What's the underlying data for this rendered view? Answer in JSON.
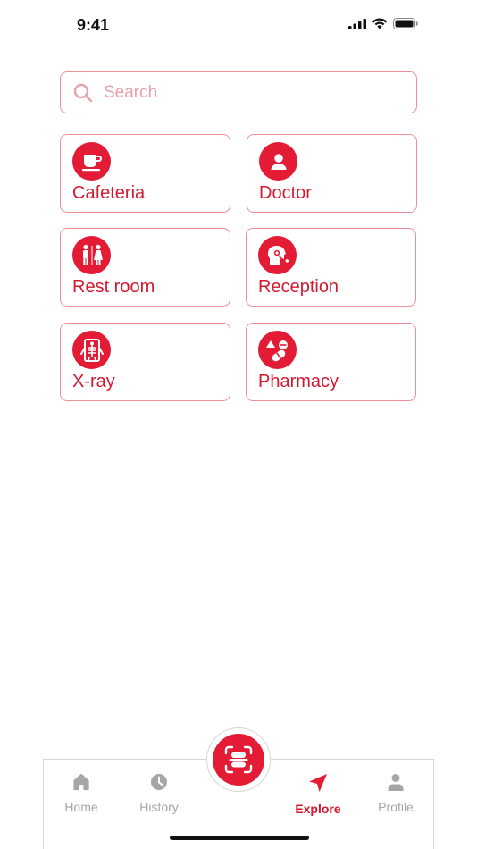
{
  "status_bar": {
    "time": "9:41"
  },
  "search": {
    "placeholder": "Search"
  },
  "categories": [
    {
      "label": "Cafeteria",
      "icon": "cafeteria-cup-icon"
    },
    {
      "label": "Doctor",
      "icon": "doctor-person-icon"
    },
    {
      "label": "Rest room",
      "icon": "restroom-icon"
    },
    {
      "label": "Reception",
      "icon": "reception-headset-icon"
    },
    {
      "label": "X-ray",
      "icon": "xray-skeleton-icon"
    },
    {
      "label": "Pharmacy",
      "icon": "pharmacy-pills-icon"
    }
  ],
  "bottom_nav": {
    "items": [
      {
        "label": "Home",
        "icon": "home-icon",
        "active": false
      },
      {
        "label": "History",
        "icon": "clock-icon",
        "active": false
      },
      {
        "label": "Explore",
        "icon": "navigation-arrow-icon",
        "active": true
      },
      {
        "label": "Profile",
        "icon": "person-icon",
        "active": false
      }
    ],
    "center_button_icon": "scan-icon"
  },
  "colors": {
    "accent": "#e31b35",
    "accent_text": "#d4192f",
    "border": "#ef8f9b",
    "inactive": "#a6a6a6"
  }
}
